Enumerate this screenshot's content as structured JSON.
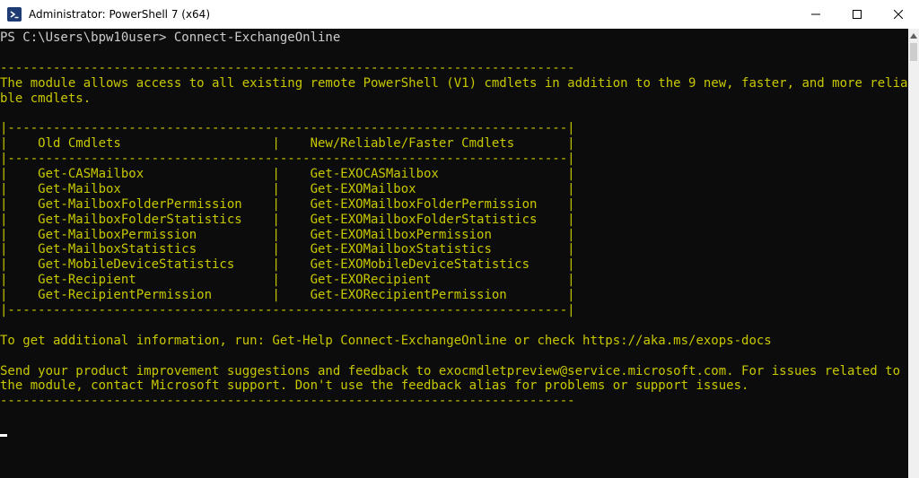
{
  "window": {
    "title": "Administrator: PowerShell 7 (x64)",
    "controls": {
      "minimize": "minimize",
      "maximize": "maximize",
      "close": "close"
    }
  },
  "console": {
    "lines": [
      {
        "text": "PS C:\\Users\\bpw10user> Connect-ExchangeOnline",
        "style": "normal"
      },
      {
        "text": "",
        "style": "normal"
      },
      {
        "text": "----------------------------------------------------------------------------",
        "style": "yellow"
      },
      {
        "text": "The module allows access to all existing remote PowerShell (V1) cmdlets in addition to the 9 new, faster, and more relia",
        "style": "yellow"
      },
      {
        "text": "ble cmdlets.",
        "style": "yellow"
      },
      {
        "text": "",
        "style": "yellow"
      },
      {
        "text": "|--------------------------------------------------------------------------|",
        "style": "yellow"
      },
      {
        "text": "|    Old Cmdlets                    |    New/Reliable/Faster Cmdlets       |",
        "style": "yellow"
      },
      {
        "text": "|--------------------------------------------------------------------------|",
        "style": "yellow"
      },
      {
        "text": "|    Get-CASMailbox                 |    Get-EXOCASMailbox                 |",
        "style": "yellow"
      },
      {
        "text": "|    Get-Mailbox                    |    Get-EXOMailbox                    |",
        "style": "yellow"
      },
      {
        "text": "|    Get-MailboxFolderPermission    |    Get-EXOMailboxFolderPermission    |",
        "style": "yellow"
      },
      {
        "text": "|    Get-MailboxFolderStatistics    |    Get-EXOMailboxFolderStatistics    |",
        "style": "yellow"
      },
      {
        "text": "|    Get-MailboxPermission          |    Get-EXOMailboxPermission          |",
        "style": "yellow"
      },
      {
        "text": "|    Get-MailboxStatistics          |    Get-EXOMailboxStatistics          |",
        "style": "yellow"
      },
      {
        "text": "|    Get-MobileDeviceStatistics     |    Get-EXOMobileDeviceStatistics     |",
        "style": "yellow"
      },
      {
        "text": "|    Get-Recipient                  |    Get-EXORecipient                  |",
        "style": "yellow"
      },
      {
        "text": "|    Get-RecipientPermission        |    Get-EXORecipientPermission        |",
        "style": "yellow"
      },
      {
        "text": "|--------------------------------------------------------------------------|",
        "style": "yellow"
      },
      {
        "text": "",
        "style": "yellow"
      },
      {
        "text": "To get additional information, run: Get-Help Connect-ExchangeOnline or check https://aka.ms/exops-docs",
        "style": "yellow"
      },
      {
        "text": "",
        "style": "yellow"
      },
      {
        "text": "Send your product improvement suggestions and feedback to exocmdletpreview@service.microsoft.com. For issues related to",
        "style": "yellow"
      },
      {
        "text": "the module, contact Microsoft support. Don't use the feedback alias for problems or support issues.",
        "style": "yellow"
      },
      {
        "text": "----------------------------------------------------------------------------",
        "style": "yellow"
      }
    ]
  },
  "colors": {
    "console_background": "#0c0c0c",
    "console_text": "#cccccc",
    "warning_text": "#c8c800",
    "titlebar_background": "#ffffff"
  },
  "icons": {
    "app": "powershell-icon",
    "minimize": "minimize-icon",
    "maximize": "maximize-icon",
    "close": "close-icon",
    "scroll_up": "scroll-up-arrow-icon"
  }
}
